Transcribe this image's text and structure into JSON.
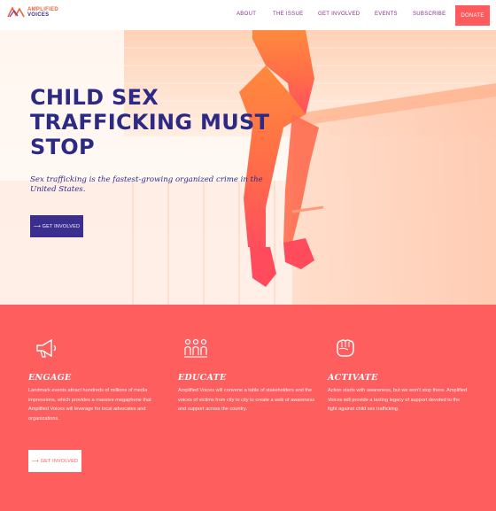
{
  "header": {
    "logo": {
      "line1": "AMPLIFIED",
      "line2": "VOICES"
    },
    "nav": [
      {
        "label": "ABOUT"
      },
      {
        "label": "THE ISSUE"
      },
      {
        "label": "GET INVOLVED"
      },
      {
        "label": "EVENTS"
      },
      {
        "label": "SUBSCRIBE"
      }
    ],
    "donate_label": "DONATE"
  },
  "hero": {
    "title_lines": [
      "CHILD SEX",
      "TRAFFICKING MUST",
      "STOP"
    ],
    "subtitle": "Sex trafficking is the fastest-growing organized crime in the United States.",
    "button_label": "⟶ GET INVOLVED"
  },
  "pillars": {
    "items": [
      {
        "icon": "megaphone-icon",
        "title": "ENGAGE",
        "text": "Landmark events attract hundreds of millions of media impressions, which provides a massive megaphone that Amplified Voices will leverage for local advocates and organizations."
      },
      {
        "icon": "people-group-icon",
        "title": "EDUCATE",
        "text": "Amplified Voices will convene a table of stakeholders and the voices of victims from city to city to create a web of awareness and support across the country."
      },
      {
        "icon": "raised-fist-icon",
        "title": "ACTIVATE",
        "text": "Action starts with awareness, but we won't stop there. Amplified Voices will provide a lasting legacy of support devoted to the fight against child sex trafficking."
      }
    ],
    "button_label": "⟶ GET INVOLVED"
  },
  "colors": {
    "brand_navy": "#2d2a86",
    "coral": "#fe5e5e",
    "nav_purple": "#8a2f8a",
    "hero_orange": "#ff8a3c"
  }
}
